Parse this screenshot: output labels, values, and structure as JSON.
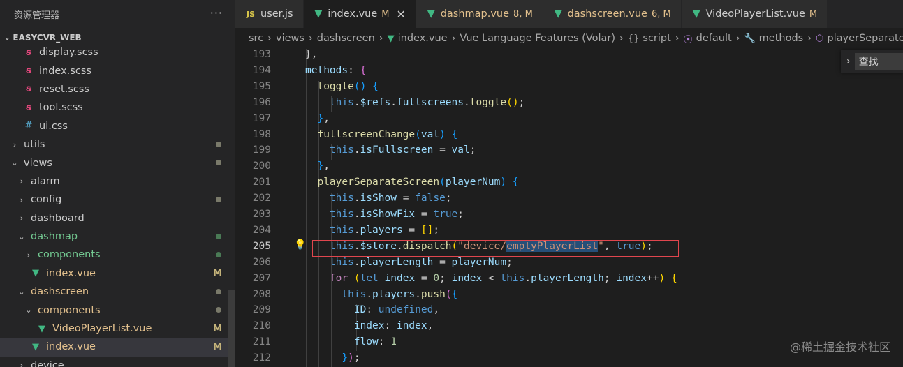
{
  "explorer": {
    "title": "资源管理器",
    "more": "···",
    "section": "EASYCVR_WEB",
    "items": [
      {
        "label": "display.scss",
        "icon": "sass-icon",
        "indent": 2
      },
      {
        "label": "index.scss",
        "icon": "sass-icon",
        "indent": 2
      },
      {
        "label": "reset.scss",
        "icon": "sass-icon",
        "indent": 2
      },
      {
        "label": "tool.scss",
        "icon": "sass-icon",
        "indent": 2
      },
      {
        "label": "ui.css",
        "icon": "css-icon",
        "indent": 2
      },
      {
        "label": "utils",
        "type": "folder",
        "open": false,
        "indent": 1,
        "dot": "grey"
      },
      {
        "label": "views",
        "type": "folder",
        "open": true,
        "indent": 1,
        "dot": "grey"
      },
      {
        "label": "alarm",
        "type": "folder",
        "open": false,
        "indent": 2
      },
      {
        "label": "config",
        "type": "folder",
        "open": false,
        "indent": 2,
        "dot": "grey"
      },
      {
        "label": "dashboard",
        "type": "folder",
        "open": false,
        "indent": 2
      },
      {
        "label": "dashmap",
        "type": "folder",
        "open": true,
        "indent": 2,
        "color": "green",
        "dot": "green"
      },
      {
        "label": "components",
        "type": "folder",
        "open": false,
        "indent": 3,
        "color": "green",
        "dot": "green"
      },
      {
        "label": "index.vue",
        "icon": "vue-icon",
        "indent": 3,
        "color": "mod",
        "mark": "M"
      },
      {
        "label": "dashscreen",
        "type": "folder",
        "open": true,
        "indent": 2,
        "color": "mod",
        "dot": "grey"
      },
      {
        "label": "components",
        "type": "folder",
        "open": true,
        "indent": 3,
        "color": "mod",
        "dot": "grey"
      },
      {
        "label": "VideoPlayerList.vue",
        "icon": "vue-icon",
        "indent": 4,
        "color": "mod",
        "mark": "M"
      },
      {
        "label": "index.vue",
        "icon": "vue-icon",
        "indent": 3,
        "color": "mod",
        "mark": "M",
        "active": true
      },
      {
        "label": "device",
        "type": "folder",
        "open": false,
        "indent": 2
      }
    ]
  },
  "tabs": [
    {
      "label": "user.js",
      "icon": "js",
      "flag": ""
    },
    {
      "label": "index.vue",
      "icon": "vue",
      "flag": "M",
      "active": true,
      "close": "✕"
    },
    {
      "label": "dashmap.vue",
      "icon": "vue",
      "flag": "8, M",
      "mod": true
    },
    {
      "label": "dashscreen.vue",
      "icon": "vue",
      "flag": "6, M",
      "mod": true
    },
    {
      "label": "VideoPlayerList.vue",
      "icon": "vue",
      "flag": "M"
    }
  ],
  "breadcrumb": [
    "src",
    "views",
    "dashscreen",
    "index.vue",
    "Vue Language Features (Volar)",
    "script",
    "default",
    "methods",
    "playerSeparateScreen"
  ],
  "find_widget": {
    "label": "查找"
  },
  "editor": {
    "current_line": 205,
    "line_numbers": [
      193,
      194,
      195,
      196,
      197,
      198,
      199,
      200,
      201,
      202,
      203,
      204,
      205,
      206,
      207,
      208,
      209,
      210,
      211,
      212
    ]
  },
  "watermark": "@稀土掘金技术社区",
  "colors": {
    "highlight_box": "#e0464e",
    "modified": "#e2c08d",
    "untracked": "#73c991"
  }
}
